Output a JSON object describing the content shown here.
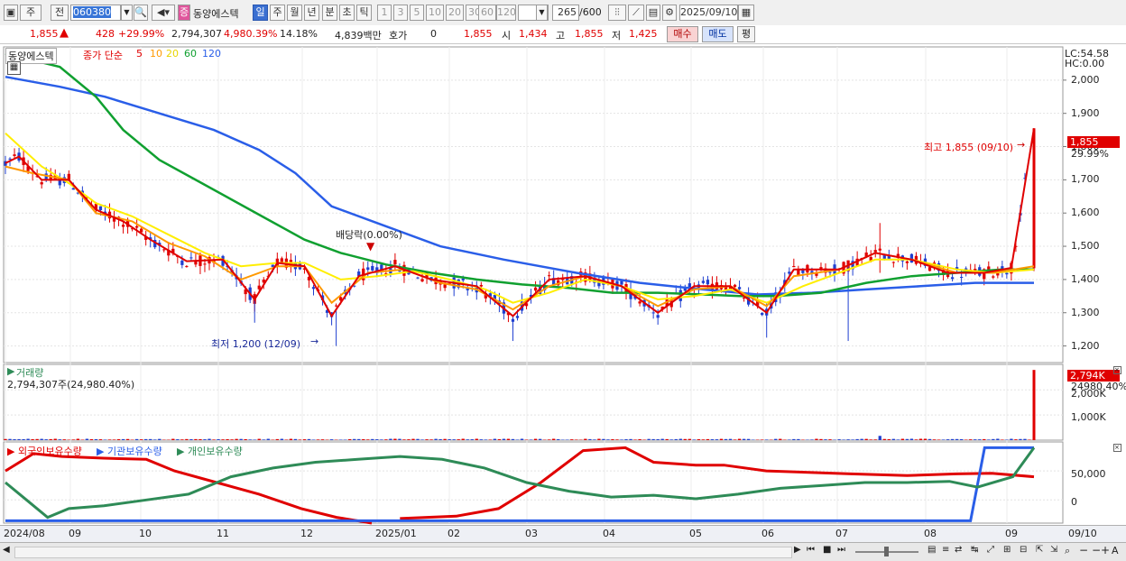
{
  "toolbar": {
    "period_type": "주",
    "prev": "전",
    "code": "060380",
    "stock_name": "동양에스텍",
    "stock_badge": "증",
    "periods": [
      "일",
      "주",
      "월",
      "년",
      "분",
      "초",
      "틱"
    ],
    "intervals": [
      "1",
      "3",
      "5",
      "10",
      "20",
      "30",
      "60",
      "120"
    ],
    "count": "265",
    "count_total": "/600",
    "date": "2025/09/10"
  },
  "info": {
    "price": "1,855",
    "change": "428",
    "change_pct": "+29.99%",
    "volume": "2,794,307",
    "volume_pct": "4,980.39%",
    "turnover": "14.18%",
    "amount": "4,839백만",
    "hoga_label": "호가",
    "hoga_value": "0",
    "ask": "1,855",
    "open_label": "시",
    "open": "1,434",
    "high_label": "고",
    "high": "1,855",
    "low_label": "저",
    "low": "1,425",
    "buy_label": "매수",
    "sell_label": "매도",
    "eval_label": "평"
  },
  "price_panel": {
    "stock_label": "동양에스텍",
    "ma_label": "종가 단순",
    "ma_periods": [
      "5",
      "10",
      "20",
      "60",
      "120"
    ],
    "ma_colors": [
      "#e00000",
      "#ff9900",
      "#ffee00",
      "#10a030",
      "#2a5ee8"
    ],
    "lc": "LC:54.58",
    "hc": "HC:0.00",
    "y_ticks": [
      "2,000",
      "1,900",
      "1,800",
      "1,700",
      "1,600",
      "1,500",
      "1,400",
      "1,300",
      "1,200"
    ],
    "price_tag": "1,855",
    "pct_tag": "29.99%",
    "high_annot": "최고 1,855 (09/10)",
    "low_annot": "최저 1,200 (12/09)",
    "div_annot": "배당락(0.00%)"
  },
  "volume_panel": {
    "title": "거래량",
    "value": "2,794,307주(24,980.40%)",
    "y_ticks": [
      "2,000K",
      "1,000K"
    ],
    "tag": "2,794K",
    "tag_pct": "24980.40%"
  },
  "holdings_panel": {
    "labels": [
      "외국인보유수량",
      "기관보유수량",
      "개인보유수량"
    ],
    "colors": [
      "#e00000",
      "#2a5ee8",
      "#2e8b57"
    ],
    "y_ticks": [
      "50,000",
      "0"
    ]
  },
  "x_axis": [
    "2024/08",
    "09",
    "10",
    "11",
    "12",
    "2025/01",
    "02",
    "03",
    "04",
    "05",
    "06",
    "07",
    "08",
    "09",
    "09/10"
  ],
  "colors": {
    "up": "#e00000",
    "down": "#1f3fd0"
  },
  "chart_data": [
    {
      "type": "candlestick",
      "title": "동양에스텍",
      "y_range": [
        1150,
        2100
      ],
      "ma5": [
        [
          0,
          1750
        ],
        [
          3,
          1770
        ],
        [
          8,
          1700
        ],
        [
          14,
          1700
        ],
        [
          20,
          1610
        ],
        [
          26,
          1575
        ],
        [
          32,
          1520
        ],
        [
          40,
          1455
        ],
        [
          48,
          1460
        ],
        [
          55,
          1340
        ],
        [
          60,
          1450
        ],
        [
          66,
          1440
        ],
        [
          72,
          1290
        ],
        [
          78,
          1410
        ],
        [
          86,
          1440
        ],
        [
          94,
          1400
        ],
        [
          104,
          1380
        ],
        [
          112,
          1290
        ],
        [
          120,
          1400
        ],
        [
          128,
          1410
        ],
        [
          136,
          1380
        ],
        [
          144,
          1300
        ],
        [
          152,
          1380
        ],
        [
          160,
          1380
        ],
        [
          168,
          1300
        ],
        [
          174,
          1430
        ],
        [
          184,
          1430
        ],
        [
          192,
          1480
        ],
        [
          200,
          1460
        ],
        [
          208,
          1420
        ],
        [
          216,
          1420
        ],
        [
          222,
          1435
        ],
        [
          227,
          1855
        ]
      ],
      "ma10": [
        [
          0,
          1740
        ],
        [
          6,
          1720
        ],
        [
          14,
          1700
        ],
        [
          20,
          1600
        ],
        [
          28,
          1575
        ],
        [
          36,
          1510
        ],
        [
          44,
          1470
        ],
        [
          52,
          1400
        ],
        [
          60,
          1440
        ],
        [
          66,
          1440
        ],
        [
          72,
          1330
        ],
        [
          80,
          1420
        ],
        [
          88,
          1430
        ],
        [
          96,
          1390
        ],
        [
          104,
          1370
        ],
        [
          112,
          1310
        ],
        [
          120,
          1380
        ],
        [
          128,
          1410
        ],
        [
          136,
          1380
        ],
        [
          144,
          1320
        ],
        [
          152,
          1370
        ],
        [
          160,
          1380
        ],
        [
          168,
          1320
        ],
        [
          174,
          1410
        ],
        [
          184,
          1430
        ],
        [
          192,
          1480
        ],
        [
          200,
          1460
        ],
        [
          210,
          1420
        ],
        [
          218,
          1420
        ],
        [
          227,
          1440
        ]
      ],
      "ma20": [
        [
          0,
          1840
        ],
        [
          8,
          1740
        ],
        [
          14,
          1690
        ],
        [
          20,
          1630
        ],
        [
          28,
          1590
        ],
        [
          36,
          1535
        ],
        [
          44,
          1480
        ],
        [
          52,
          1440
        ],
        [
          60,
          1450
        ],
        [
          66,
          1450
        ],
        [
          74,
          1400
        ],
        [
          82,
          1410
        ],
        [
          90,
          1425
        ],
        [
          98,
          1400
        ],
        [
          106,
          1370
        ],
        [
          112,
          1330
        ],
        [
          120,
          1360
        ],
        [
          128,
          1400
        ],
        [
          136,
          1380
        ],
        [
          144,
          1340
        ],
        [
          152,
          1350
        ],
        [
          160,
          1370
        ],
        [
          168,
          1330
        ],
        [
          176,
          1380
        ],
        [
          184,
          1420
        ],
        [
          192,
          1460
        ],
        [
          200,
          1460
        ],
        [
          210,
          1430
        ],
        [
          218,
          1420
        ],
        [
          227,
          1430
        ]
      ],
      "ma60": [
        [
          0,
          2080
        ],
        [
          12,
          2040
        ],
        [
          20,
          1950
        ],
        [
          26,
          1850
        ],
        [
          34,
          1760
        ],
        [
          42,
          1700
        ],
        [
          50,
          1640
        ],
        [
          58,
          1580
        ],
        [
          66,
          1520
        ],
        [
          74,
          1480
        ],
        [
          84,
          1445
        ],
        [
          94,
          1420
        ],
        [
          104,
          1400
        ],
        [
          114,
          1385
        ],
        [
          124,
          1375
        ],
        [
          134,
          1360
        ],
        [
          144,
          1360
        ],
        [
          154,
          1355
        ],
        [
          162,
          1350
        ],
        [
          170,
          1350
        ],
        [
          180,
          1360
        ],
        [
          190,
          1390
        ],
        [
          200,
          1410
        ],
        [
          210,
          1420
        ],
        [
          220,
          1430
        ],
        [
          227,
          1430
        ]
      ],
      "ma120": [
        [
          0,
          2010
        ],
        [
          12,
          1980
        ],
        [
          22,
          1950
        ],
        [
          34,
          1900
        ],
        [
          46,
          1850
        ],
        [
          56,
          1790
        ],
        [
          64,
          1720
        ],
        [
          72,
          1620
        ],
        [
          84,
          1560
        ],
        [
          96,
          1500
        ],
        [
          110,
          1460
        ],
        [
          126,
          1420
        ],
        [
          140,
          1390
        ],
        [
          154,
          1370
        ],
        [
          166,
          1355
        ],
        [
          178,
          1360
        ],
        [
          190,
          1370
        ],
        [
          202,
          1380
        ],
        [
          214,
          1390
        ],
        [
          227,
          1390
        ]
      ]
    },
    {
      "type": "bar",
      "title": "거래량",
      "y_range": [
        0,
        2800000
      ],
      "last_value": 2794307
    },
    {
      "type": "line",
      "title": "보유수량",
      "y_range": [
        -40000,
        100000
      ],
      "series": [
        {
          "name": "외국인보유수량",
          "color": "#e00000",
          "points": [
            [
              0,
              50000
            ],
            [
              8,
              80000
            ],
            [
              16,
              75000
            ],
            [
              28,
              72000
            ],
            [
              40,
              70000
            ],
            [
              48,
              50000
            ],
            [
              60,
              30000
            ],
            [
              72,
              10000
            ],
            [
              84,
              -15000
            ],
            [
              94,
              -30000
            ],
            [
              104,
              -40000
            ]
          ]
        },
        {
          "name": "외국인보유수량",
          "color": "#e00000",
          "points": [
            [
              112,
              -32000
            ],
            [
              128,
              -28000
            ],
            [
              140,
              -15000
            ],
            [
              152,
              30000
            ],
            [
              164,
              85000
            ],
            [
              176,
              90000
            ],
            [
              184,
              65000
            ],
            [
              196,
              60000
            ],
            [
              204,
              60000
            ],
            [
              216,
              50000
            ],
            [
              240,
              45000
            ],
            [
              256,
              42000
            ],
            [
              270,
              45000
            ],
            [
              280,
              46000
            ],
            [
              292,
              40000
            ]
          ]
        },
        {
          "name": "기관보유수량",
          "color": "#2a5ee8",
          "points": [
            [
              0,
              -36000
            ],
            [
              274,
              -36000
            ],
            [
              278,
              90000
            ],
            [
              292,
              90000
            ]
          ]
        },
        {
          "name": "개인보유수량",
          "color": "#2e8b57",
          "points": [
            [
              0,
              30000
            ],
            [
              6,
              0
            ],
            [
              12,
              -30000
            ],
            [
              18,
              -15000
            ],
            [
              28,
              -10000
            ],
            [
              40,
              0
            ],
            [
              52,
              10000
            ],
            [
              64,
              40000
            ],
            [
              76,
              55000
            ],
            [
              88,
              65000
            ],
            [
              100,
              70000
            ],
            [
              112,
              75000
            ],
            [
              124,
              70000
            ],
            [
              136,
              55000
            ],
            [
              148,
              30000
            ],
            [
              160,
              15000
            ],
            [
              172,
              5000
            ],
            [
              184,
              8000
            ],
            [
              196,
              2000
            ],
            [
              208,
              10000
            ],
            [
              220,
              20000
            ],
            [
              232,
              25000
            ],
            [
              244,
              30000
            ],
            [
              256,
              30000
            ],
            [
              268,
              32000
            ],
            [
              276,
              22000
            ],
            [
              286,
              40000
            ],
            [
              292,
              90000
            ]
          ]
        }
      ]
    }
  ]
}
